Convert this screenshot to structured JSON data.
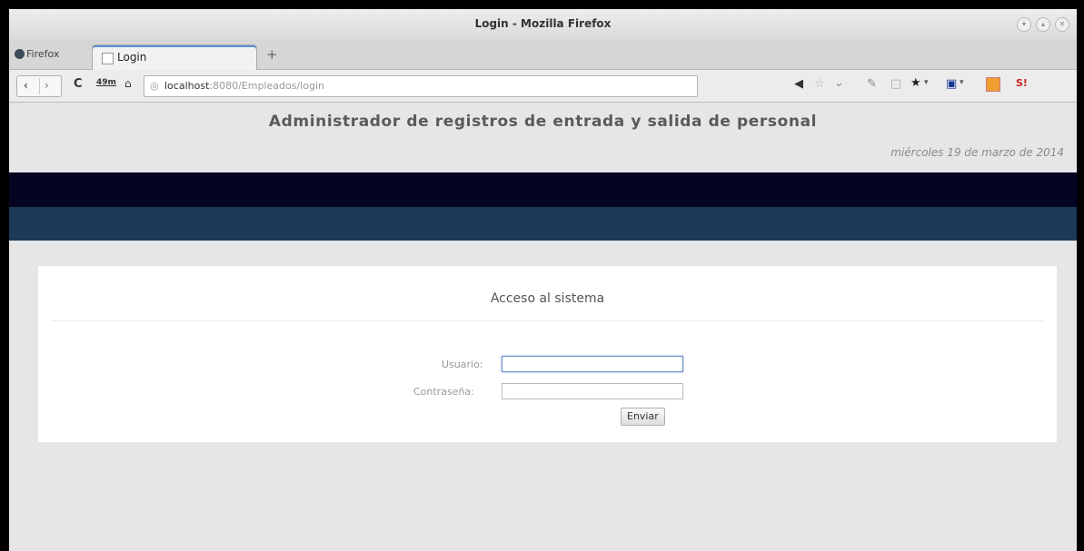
{
  "window": {
    "title": "Login - Mozilla Firefox",
    "controls": [
      "minimize-icon",
      "maximize-icon",
      "close-icon"
    ]
  },
  "tabbar": {
    "browser_menu_label": "Firefox",
    "tabs": [
      {
        "label": "Login",
        "active": true
      }
    ],
    "new_tab_label": "+"
  },
  "navbar": {
    "extension_badge": "49m",
    "url_host": "localhost",
    "url_rest": ":8080/Empleados/login"
  },
  "page": {
    "header": "Administrador de registros de entrada y salida de personal",
    "date": "miércoles 19 de marzo de 2014",
    "colors": {
      "band_dark": "#050423",
      "band_teal": "#1a3a57",
      "background": "#e6e6e6"
    }
  },
  "login": {
    "title": "Acceso al sistema",
    "user_label": "Usuario:",
    "user_value": "",
    "password_label": "Contraseña:",
    "password_value": "",
    "submit_label": "Enviar"
  }
}
